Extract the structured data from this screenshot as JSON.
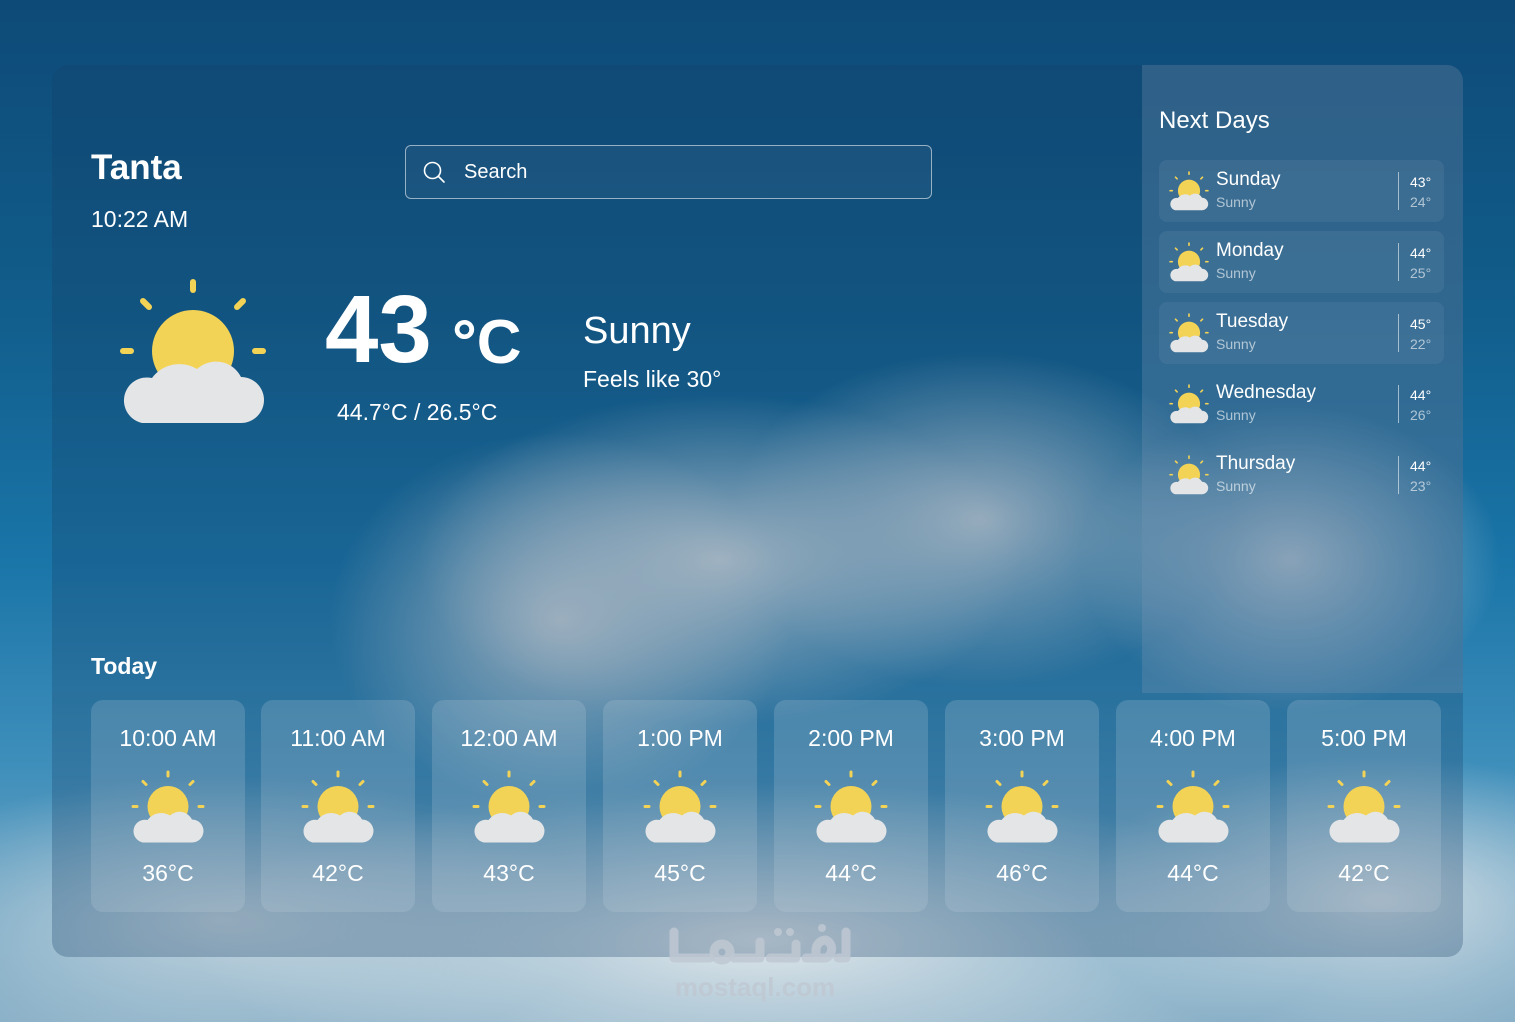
{
  "location": {
    "city": "Tanta",
    "time": "10:22 AM"
  },
  "search": {
    "placeholder": "Search"
  },
  "current": {
    "temp": "43",
    "unit": "°C",
    "min_max": "44.7°C / 26.5°C",
    "condition": "Sunny",
    "feels_like": "Feels like 30°",
    "icon": "partly-sunny-icon"
  },
  "next_days": {
    "title": "Next Days",
    "items": [
      {
        "day": "Sunday",
        "condition": "Sunny",
        "high": "43°",
        "low": "24°"
      },
      {
        "day": "Monday",
        "condition": "Sunny",
        "high": "44°",
        "low": "25°"
      },
      {
        "day": "Tuesday",
        "condition": "Sunny",
        "high": "45°",
        "low": "22°"
      },
      {
        "day": "Wednesday",
        "condition": "Sunny",
        "high": "44°",
        "low": "26°"
      },
      {
        "day": "Thursday",
        "condition": "Sunny",
        "high": "44°",
        "low": "23°"
      }
    ]
  },
  "today": {
    "title": "Today",
    "hours": [
      {
        "time": "10:00 AM",
        "temp": "36°C"
      },
      {
        "time": "11:00 AM",
        "temp": "42°C"
      },
      {
        "time": "12:00 AM",
        "temp": "43°C"
      },
      {
        "time": "1:00 PM",
        "temp": "45°C"
      },
      {
        "time": "2:00 PM",
        "temp": "44°C"
      },
      {
        "time": "3:00 PM",
        "temp": "46°C"
      },
      {
        "time": "4:00 PM",
        "temp": "44°C"
      },
      {
        "time": "5:00 PM",
        "temp": "42°C"
      }
    ]
  },
  "watermark": {
    "arabic": "مستقل",
    "site": "mostaql.com"
  },
  "colors": {
    "sun": "#f3d356",
    "cloud": "#e4e5e6",
    "text": "#ffffff"
  }
}
